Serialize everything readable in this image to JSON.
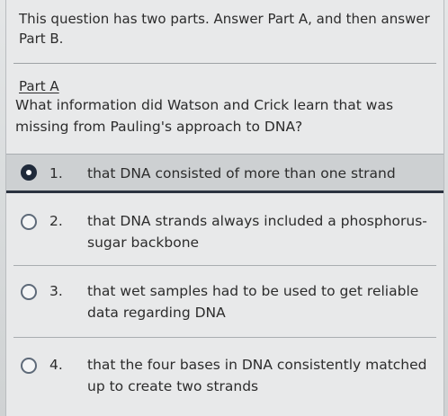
{
  "intro": {
    "text": "This question has two parts. Answer Part A, and then answer Part B."
  },
  "part": {
    "label": "Part A",
    "question": "What information did Watson and Crick learn that was missing from Pauling's approach to DNA?"
  },
  "options": [
    {
      "number": "1.",
      "text": "that DNA consisted of more than one strand",
      "selected": true
    },
    {
      "number": "2.",
      "text": "that DNA strands always included a phosphorus-sugar backbone",
      "selected": false
    },
    {
      "number": "3.",
      "text": "that wet samples had to be used to get reliable data regarding DNA",
      "selected": false
    },
    {
      "number": "4.",
      "text": "that the four bases in DNA consistently matched up to create two strands",
      "selected": false
    }
  ],
  "colors": {
    "selected_accent": "#2b3340",
    "text": "#2c2c2c",
    "background": "#e8e9ea"
  }
}
